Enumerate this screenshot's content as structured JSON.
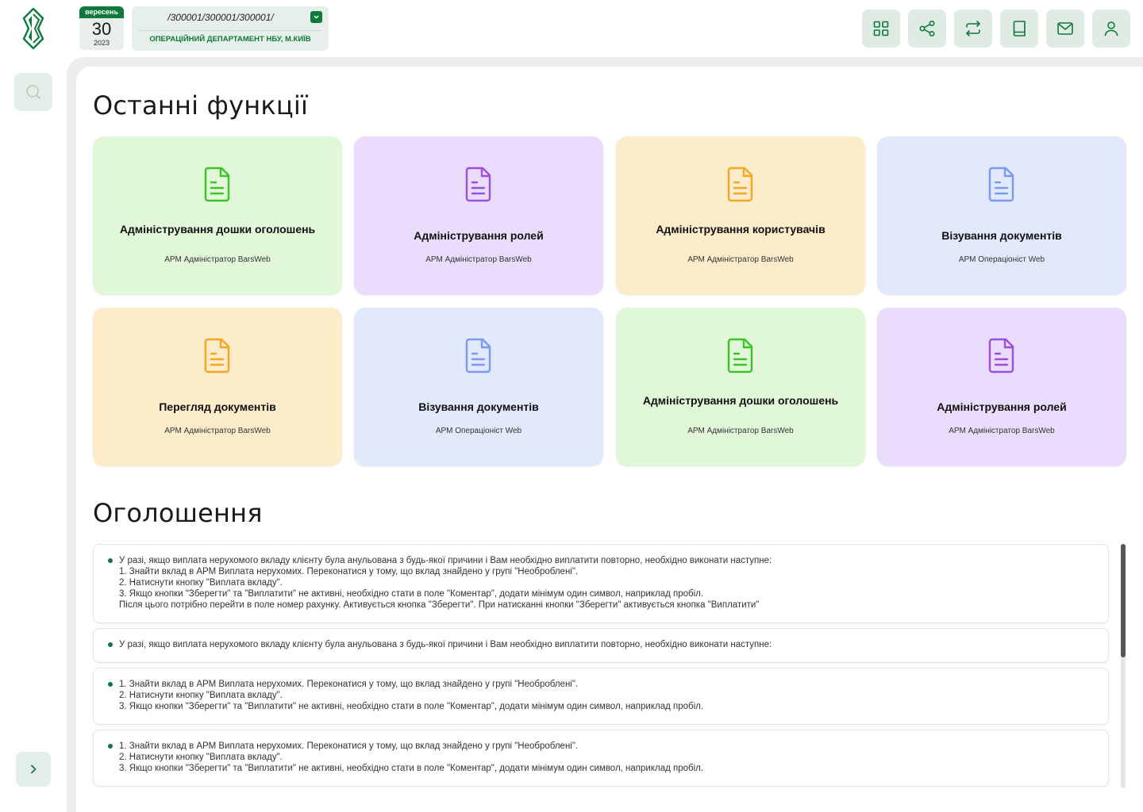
{
  "header": {
    "date": {
      "month": "вересень",
      "day": "30",
      "year": "2023"
    },
    "branch": {
      "code": "/300001/300001/300001/",
      "department": "ОПЕРАЦІЙНИЙ ДЕПАРТАМЕНТ НБУ, М.КИЇВ"
    },
    "toolbar_icons": [
      "grid-icon",
      "share-icon",
      "exchange-icon",
      "book-icon",
      "mail-icon",
      "user-icon"
    ]
  },
  "recent": {
    "title": "Останні функції",
    "cards": [
      {
        "title": "Адміністрування дошки оголошень",
        "subtitle": "АРМ Адміністратор BarsWeb",
        "theme": "green"
      },
      {
        "title": "Адміністрування ролей",
        "subtitle": "АРМ Адміністратор BarsWeb",
        "theme": "purple"
      },
      {
        "title": "Адміністрування користувачів",
        "subtitle": "АРМ Адміністратор BarsWeb",
        "theme": "orange"
      },
      {
        "title": "Візування документів",
        "subtitle": "АРМ Операціоніст Web",
        "theme": "blue"
      },
      {
        "title": "Перегляд документів",
        "subtitle": "АРМ Адміністратор BarsWeb",
        "theme": "orange"
      },
      {
        "title": "Візування документів",
        "subtitle": "АРМ Операціоніст Web",
        "theme": "blue"
      },
      {
        "title": "Адміністрування дошки оголошень",
        "subtitle": "АРМ Адміністратор BarsWeb",
        "theme": "green"
      },
      {
        "title": "Адміністрування ролей",
        "subtitle": "АРМ Адміністратор BarsWeb",
        "theme": "purple"
      }
    ]
  },
  "announcements": {
    "title": "Оголошення",
    "items": [
      {
        "lines": [
          "У разі, якщо виплата нерухомого вкладу клієнту була анульована з будь-якої причини і Вам необхідно виплатити повторно, необхідно виконати наступне:",
          "1. Знайти вклад в АРМ Виплата нерухомих. Переконатися у тому, що вклад знайдено у групі \"Необроблені\".",
          "2. Натиснути кнопку \"Виплата вкладу\".",
          "3. Якщо кнопки \"Зберегти\" та \"Виплатити\" не активні, необхідно стати в поле \"Коментар\", додати мінімум один символ, наприклад пробіл.",
          "Після цього потрібно перейти в поле номер рахунку. Активується кнопка \"Зберегти\". При натисканні кнопки \"Зберегти\" активується кнопка \"Виплатити\""
        ]
      },
      {
        "lines": [
          "У разі, якщо виплата нерухомого вкладу клієнту була анульована з будь-якої причини і Вам необхідно виплатити повторно, необхідно виконати наступне:"
        ]
      },
      {
        "lines": [
          "1. Знайти вклад в АРМ Виплата нерухомих. Переконатися у тому, що вклад знайдено у групі \"Необроблені\".",
          "2. Натиснути кнопку \"Виплата вкладу\".",
          "3. Якщо кнопки \"Зберегти\" та \"Виплатити\" не активні, необхідно стати в поле \"Коментар\", додати мінімум один символ, наприклад пробіл."
        ]
      },
      {
        "lines": [
          "1. Знайти вклад в АРМ Виплата нерухомих. Переконатися у тому, що вклад знайдено у групі \"Необроблені\".",
          "2. Натиснути кнопку \"Виплата вкладу\".",
          "3. Якщо кнопки \"Зберегти\" та \"Виплатити\" не активні, необхідно стати в поле \"Коментар\", додати мінімум один символ, наприклад пробіл."
        ]
      }
    ]
  },
  "colors": {
    "brand": "#0d7a3b",
    "green_bg": "#e0f8d8",
    "green_icon": "#3ec22a",
    "purple_bg": "#e9dcfc",
    "purple_icon": "#9b4fe0",
    "orange_bg": "#fdecca",
    "orange_icon": "#f5a623",
    "blue_bg": "#e3e9fd",
    "blue_icon": "#7a9af0"
  }
}
